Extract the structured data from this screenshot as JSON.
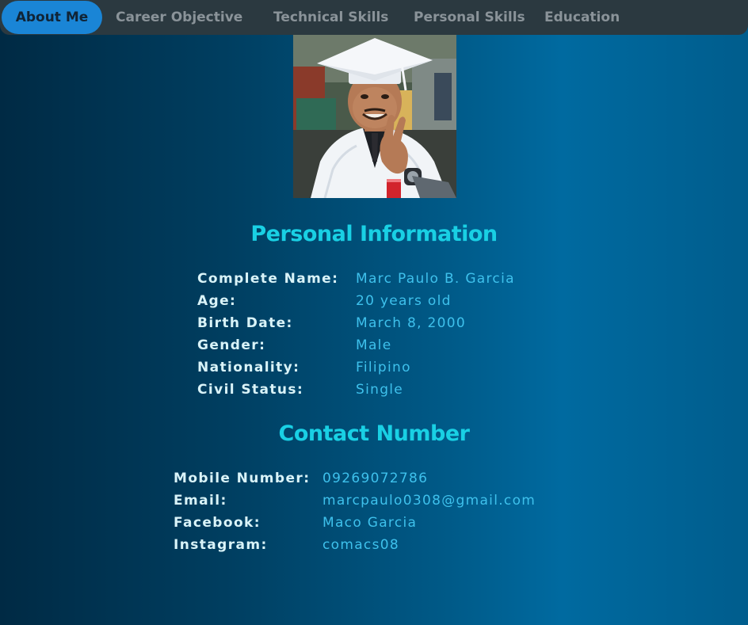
{
  "nav": {
    "tabs": [
      {
        "label": "About Me",
        "active": true
      },
      {
        "label": "Career Objective",
        "active": false
      },
      {
        "label": "Technical Skills",
        "active": false
      },
      {
        "label": "Personal Skills",
        "active": false
      },
      {
        "label": "Education",
        "active": false
      }
    ]
  },
  "personal_info": {
    "title": "Personal Information",
    "rows": [
      {
        "label": "Complete Name:",
        "value": "Marc Paulo B. Garcia"
      },
      {
        "label": "Age:",
        "value": "20 years old"
      },
      {
        "label": "Birth Date:",
        "value": "March 8, 2000"
      },
      {
        "label": "Gender:",
        "value": "Male"
      },
      {
        "label": "Nationality:",
        "value": "Filipino"
      },
      {
        "label": "Civil Status:",
        "value": "Single"
      }
    ]
  },
  "contact": {
    "title": "Contact Number",
    "rows": [
      {
        "label": "Mobile Number:",
        "value": "09269072786"
      },
      {
        "label": "Email:",
        "value": "marcpaulo0308@gmail.com"
      },
      {
        "label": "Facebook:",
        "value": "Maco Garcia"
      },
      {
        "label": "Instagram:",
        "value": "comacs08"
      }
    ]
  },
  "colors": {
    "accent_title": "#19d0e4",
    "active_tab": "#1a85d6",
    "value_text": "#3ec1ec",
    "label_text": "#d9f3f8",
    "nav_bg": "#2b3940"
  }
}
